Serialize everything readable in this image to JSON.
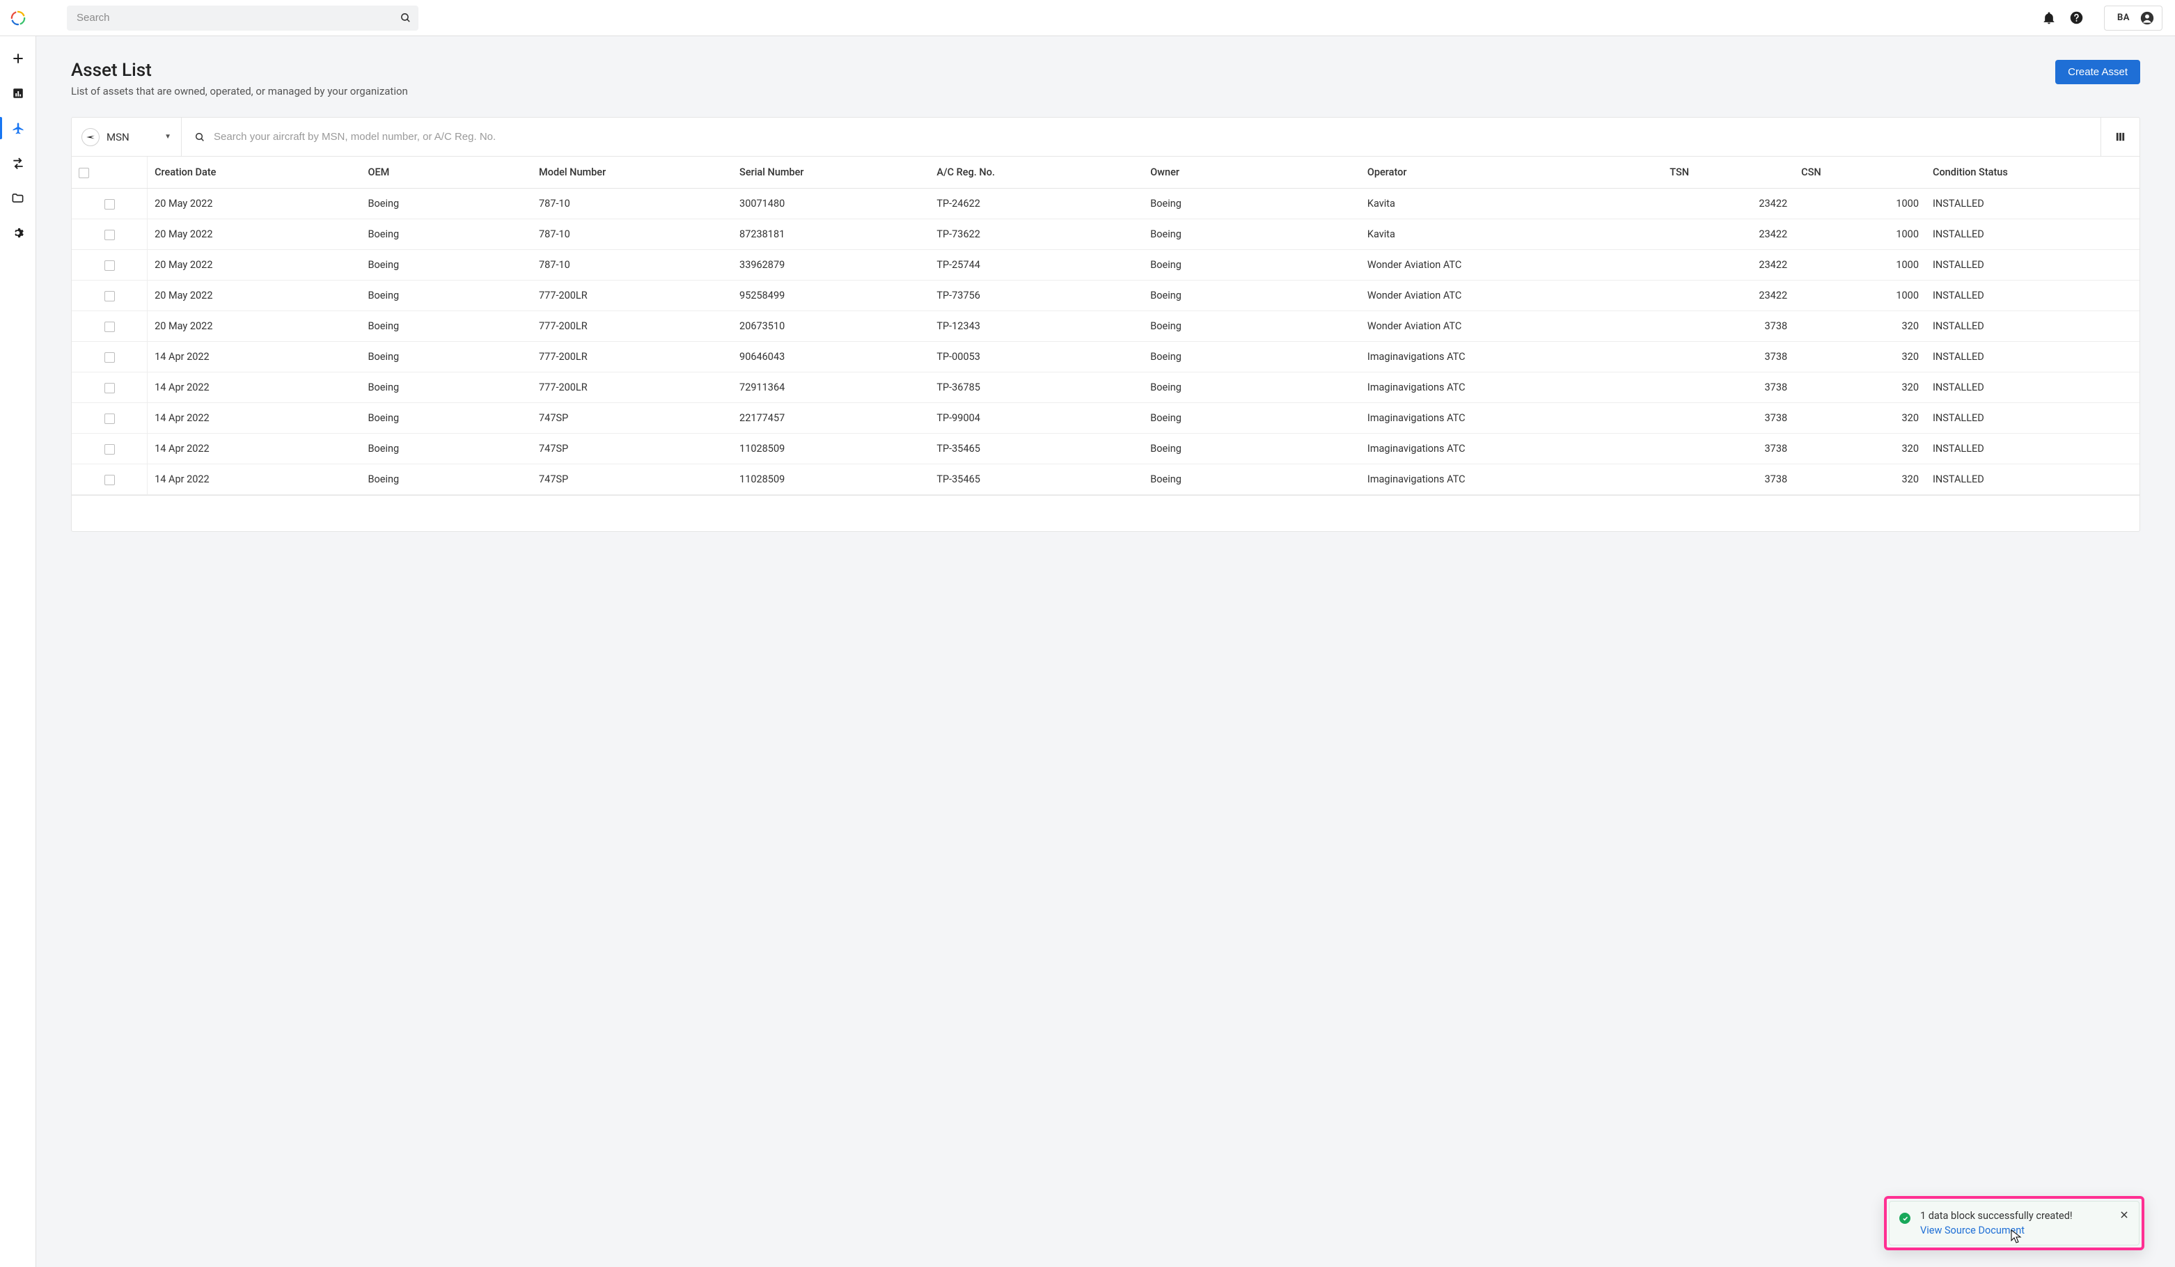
{
  "header": {
    "search_placeholder": "Search",
    "user_initials": "BA"
  },
  "sidebar": {
    "items": [
      {
        "name": "add",
        "active": false
      },
      {
        "name": "dashboard",
        "active": false
      },
      {
        "name": "assets",
        "active": true
      },
      {
        "name": "transfers",
        "active": false
      },
      {
        "name": "folders",
        "active": false
      },
      {
        "name": "settings",
        "active": false
      }
    ]
  },
  "page": {
    "title": "Asset List",
    "subtitle": "List of assets that are owned, operated, or managed by your organization",
    "create_button": "Create Asset"
  },
  "filter": {
    "selected_label": "MSN",
    "search_placeholder": "Search your aircraft by MSN, model number, or A/C Reg. No."
  },
  "columns": {
    "creation_date": "Creation Date",
    "oem": "OEM",
    "model_number": "Model Number",
    "serial_number": "Serial Number",
    "reg_no": "A/C Reg. No.",
    "owner": "Owner",
    "operator": "Operator",
    "tsn": "TSN",
    "csn": "CSN",
    "condition": "Condition Status"
  },
  "rows": [
    {
      "creation_date": "20 May 2022",
      "oem": "Boeing",
      "model_number": "787-10",
      "serial_number": "30071480",
      "reg_no": "TP-24622",
      "owner": "Boeing",
      "operator": "Kavita",
      "tsn": "23422",
      "csn": "1000",
      "condition": "INSTALLED"
    },
    {
      "creation_date": "20 May 2022",
      "oem": "Boeing",
      "model_number": "787-10",
      "serial_number": "87238181",
      "reg_no": "TP-73622",
      "owner": "Boeing",
      "operator": "Kavita",
      "tsn": "23422",
      "csn": "1000",
      "condition": "INSTALLED"
    },
    {
      "creation_date": "20 May 2022",
      "oem": "Boeing",
      "model_number": "787-10",
      "serial_number": "33962879",
      "reg_no": "TP-25744",
      "owner": "Boeing",
      "operator": "Wonder Aviation ATC",
      "tsn": "23422",
      "csn": "1000",
      "condition": "INSTALLED"
    },
    {
      "creation_date": "20 May 2022",
      "oem": "Boeing",
      "model_number": "777-200LR",
      "serial_number": "95258499",
      "reg_no": "TP-73756",
      "owner": "Boeing",
      "operator": "Wonder Aviation ATC",
      "tsn": "23422",
      "csn": "1000",
      "condition": "INSTALLED"
    },
    {
      "creation_date": "20 May 2022",
      "oem": "Boeing",
      "model_number": "777-200LR",
      "serial_number": "20673510",
      "reg_no": "TP-12343",
      "owner": "Boeing",
      "operator": "Wonder Aviation ATC",
      "tsn": "3738",
      "csn": "320",
      "condition": "INSTALLED"
    },
    {
      "creation_date": "14 Apr 2022",
      "oem": "Boeing",
      "model_number": "777-200LR",
      "serial_number": "90646043",
      "reg_no": "TP-00053",
      "owner": "Boeing",
      "operator": "Imaginavigations ATC",
      "tsn": "3738",
      "csn": "320",
      "condition": "INSTALLED"
    },
    {
      "creation_date": "14 Apr 2022",
      "oem": "Boeing",
      "model_number": "777-200LR",
      "serial_number": "72911364",
      "reg_no": "TP-36785",
      "owner": "Boeing",
      "operator": "Imaginavigations ATC",
      "tsn": "3738",
      "csn": "320",
      "condition": "INSTALLED"
    },
    {
      "creation_date": "14 Apr 2022",
      "oem": "Boeing",
      "model_number": "747SP",
      "serial_number": "22177457",
      "reg_no": "TP-99004",
      "owner": "Boeing",
      "operator": "Imaginavigations ATC",
      "tsn": "3738",
      "csn": "320",
      "condition": "INSTALLED"
    },
    {
      "creation_date": "14 Apr 2022",
      "oem": "Boeing",
      "model_number": "747SP",
      "serial_number": "11028509",
      "reg_no": "TP-35465",
      "owner": "Boeing",
      "operator": "Imaginavigations ATC",
      "tsn": "3738",
      "csn": "320",
      "condition": "INSTALLED"
    },
    {
      "creation_date": "14 Apr 2022",
      "oem": "Boeing",
      "model_number": "747SP",
      "serial_number": "11028509",
      "reg_no": "TP-35465",
      "owner": "Boeing",
      "operator": "Imaginavigations ATC",
      "tsn": "3738",
      "csn": "320",
      "condition": "INSTALLED"
    }
  ],
  "toast": {
    "message": "1 data block successfully created!",
    "link": "View Source Document"
  }
}
